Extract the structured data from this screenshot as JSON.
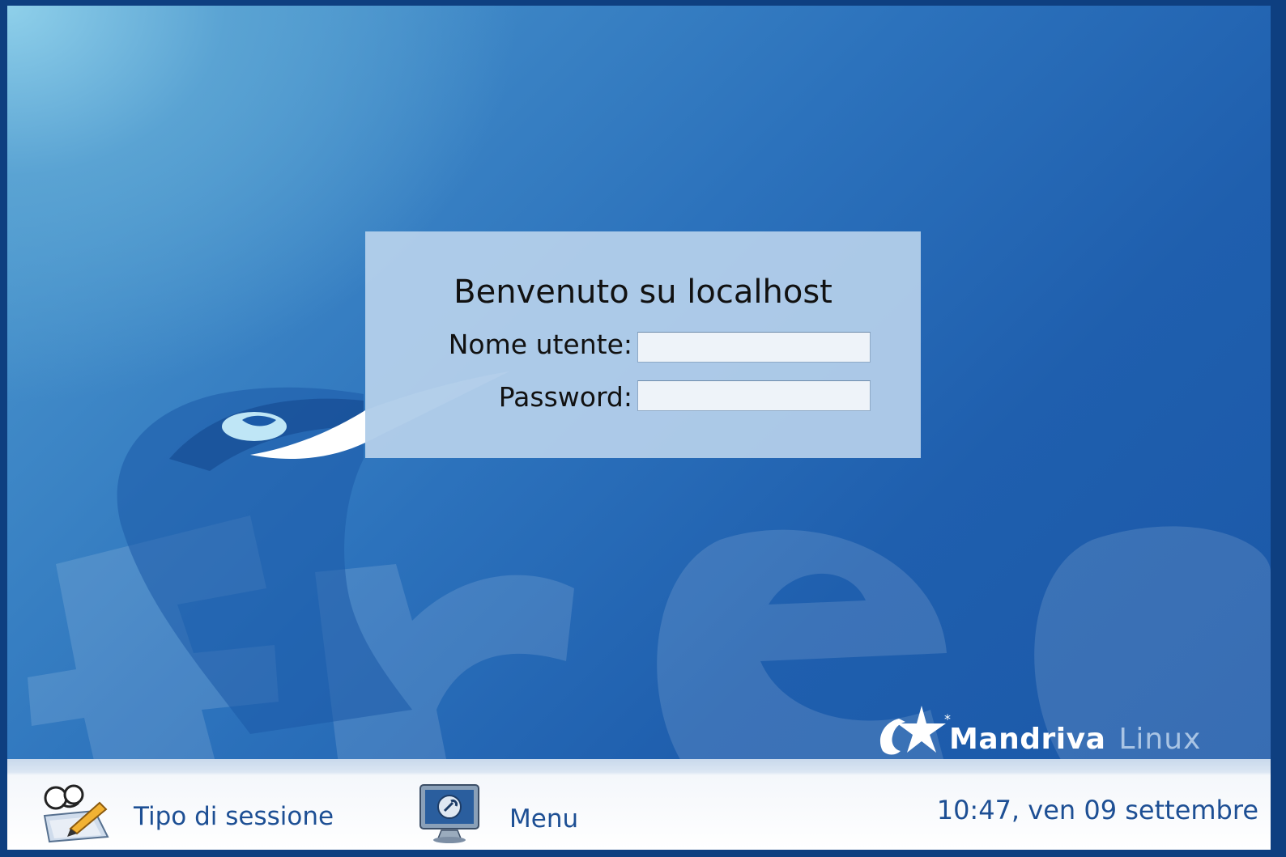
{
  "login": {
    "title": "Benvenuto su localhost",
    "username_label": "Nome utente:",
    "username_value": "",
    "password_label": "Password:",
    "password_value": ""
  },
  "wallpaper": {
    "background_word": "free",
    "brand_name": "Mandriva",
    "brand_suffix": "Linux"
  },
  "bottom_bar": {
    "session_type_label": "Tipo di sessione",
    "menu_label": "Menu",
    "clock": "10:47, ven 09 settembre"
  },
  "icons": {
    "session": "session-type-icon",
    "menu": "menu-monitor-icon",
    "brand": "mandriva-star-icon"
  },
  "colors": {
    "accent_text": "#1d4f94",
    "dialog_bg": "#bed6ee",
    "wallpaper_dark": "#1b58a8"
  }
}
